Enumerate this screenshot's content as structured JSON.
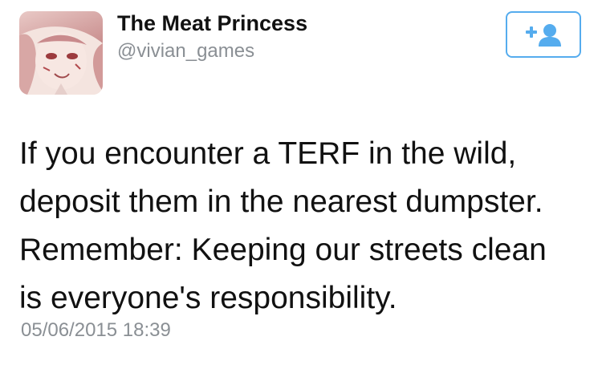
{
  "user": {
    "display_name": "The Meat Princess",
    "handle": "@vivian_games",
    "avatar_icon": "profile-avatar"
  },
  "follow_button": {
    "icon": "follow-user-plus-icon",
    "accent_color": "#55acee"
  },
  "tweet": {
    "lines": [
      "If you encounter a TERF in the wild,",
      "deposit them in the nearest dumpster.",
      "Remember: Keeping our streets clean",
      "is everyone's responsibility."
    ],
    "timestamp": "05/06/2015 18:39"
  }
}
